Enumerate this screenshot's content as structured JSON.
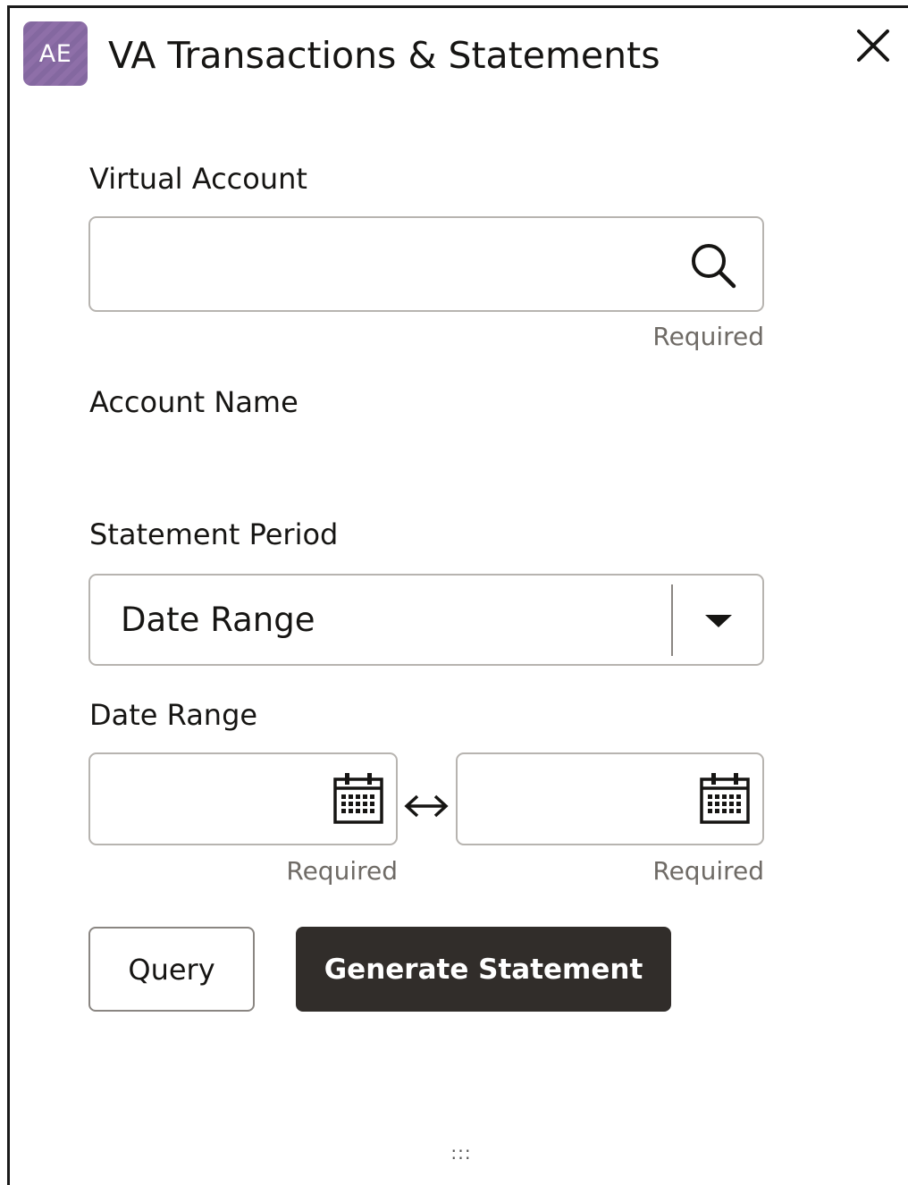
{
  "header": {
    "avatar_initials": "AE",
    "title": "VA Transactions & Statements",
    "close_icon": "close-icon",
    "avatar_color": "#8e6fa8"
  },
  "virtual_account": {
    "label": "Virtual Account",
    "value": "",
    "placeholder": "",
    "search_icon": "search-icon",
    "hint": "Required"
  },
  "account_name": {
    "label": "Account Name",
    "value": ""
  },
  "statement_period": {
    "label": "Statement Period",
    "selected": "Date Range",
    "dropdown_icon": "caret-down-icon"
  },
  "date_range": {
    "label": "Date Range",
    "from": {
      "value": "",
      "hint": "Required",
      "icon": "calendar-icon"
    },
    "separator_icon": "left-right-arrow-icon",
    "to": {
      "value": "",
      "hint": "Required",
      "icon": "calendar-icon"
    }
  },
  "actions": {
    "query_label": "Query",
    "generate_label": "Generate Statement",
    "primary_color": "#312d2a"
  },
  "footer": {
    "drag_handle": ":::"
  }
}
